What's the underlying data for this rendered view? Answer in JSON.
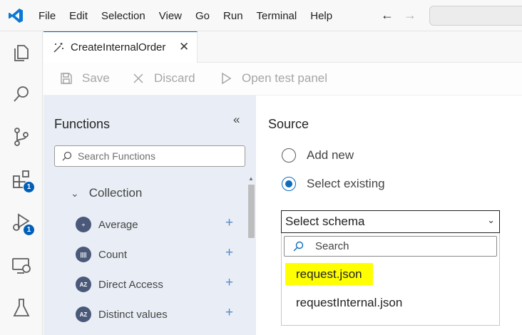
{
  "menu": [
    "File",
    "Edit",
    "Selection",
    "View",
    "Go",
    "Run",
    "Terminal",
    "Help"
  ],
  "activity": {
    "extensions_badge": "1",
    "debug_badge": "1"
  },
  "tab": {
    "label": "CreateInternalOrder"
  },
  "toolbar": {
    "save": "Save",
    "discard": "Discard",
    "open_test_panel": "Open test panel"
  },
  "functions": {
    "title": "Functions",
    "search_placeholder": "Search Functions",
    "group": "Collection",
    "items": [
      {
        "label": "Average",
        "icon": "average-icon"
      },
      {
        "label": "Count",
        "icon": "count-icon"
      },
      {
        "label": "Direct Access",
        "icon": "direct-access-icon"
      },
      {
        "label": "Distinct values",
        "icon": "distinct-values-icon"
      }
    ]
  },
  "source": {
    "title": "Source",
    "add_new": "Add new",
    "select_existing": "Select existing",
    "selected_option": "select_existing",
    "schema_select": "Select schema",
    "dropdown_search_placeholder": "Search",
    "options": [
      "request.json",
      "requestInternal.json"
    ],
    "highlighted_option": "request.json"
  },
  "colors": {
    "accent": "#005fb8",
    "functions_panel_bg": "#e9eef6",
    "highlight": "#ffff00"
  }
}
